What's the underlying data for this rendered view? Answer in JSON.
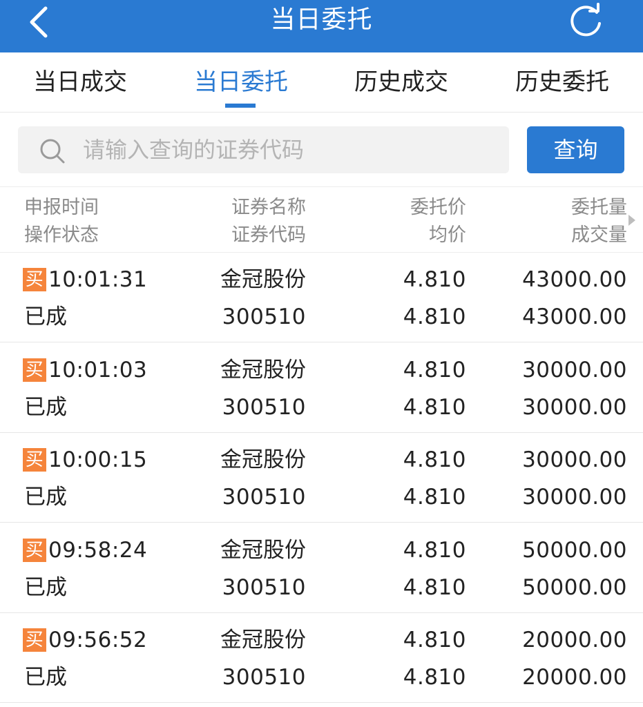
{
  "topbar": {
    "title": "当日委托",
    "back_icon": "chevron-left-icon",
    "refresh_icon": "refresh-icon",
    "color": "#2a7ad2"
  },
  "tabs": [
    {
      "label": "当日成交",
      "active": false
    },
    {
      "label": "当日委托",
      "active": true
    },
    {
      "label": "历史成交",
      "active": false
    },
    {
      "label": "历史委托",
      "active": false
    }
  ],
  "search": {
    "placeholder": "请输入查询的证券代码",
    "button_label": "查询"
  },
  "table_header": {
    "col1": [
      "申报时间",
      "操作状态"
    ],
    "col2": [
      "证券名称",
      "证券代码"
    ],
    "col3": [
      "委托价",
      "均价"
    ],
    "col4": [
      "委托量",
      "成交量"
    ]
  },
  "rows": [
    {
      "side": "买",
      "time": "10:01:31",
      "status": "已成",
      "name": "金冠股份",
      "code": "300510",
      "price": "4.810",
      "avg_price": "4.810",
      "order_qty": "43000.00",
      "filled_qty": "43000.00"
    },
    {
      "side": "买",
      "time": "10:01:03",
      "status": "已成",
      "name": "金冠股份",
      "code": "300510",
      "price": "4.810",
      "avg_price": "4.810",
      "order_qty": "30000.00",
      "filled_qty": "30000.00"
    },
    {
      "side": "买",
      "time": "10:00:15",
      "status": "已成",
      "name": "金冠股份",
      "code": "300510",
      "price": "4.810",
      "avg_price": "4.810",
      "order_qty": "30000.00",
      "filled_qty": "30000.00"
    },
    {
      "side": "买",
      "time": "09:58:24",
      "status": "已成",
      "name": "金冠股份",
      "code": "300510",
      "price": "4.810",
      "avg_price": "4.810",
      "order_qty": "50000.00",
      "filled_qty": "50000.00"
    },
    {
      "side": "买",
      "time": "09:56:52",
      "status": "已成",
      "name": "金冠股份",
      "code": "300510",
      "price": "4.810",
      "avg_price": "4.810",
      "order_qty": "20000.00",
      "filled_qty": "20000.00"
    }
  ]
}
